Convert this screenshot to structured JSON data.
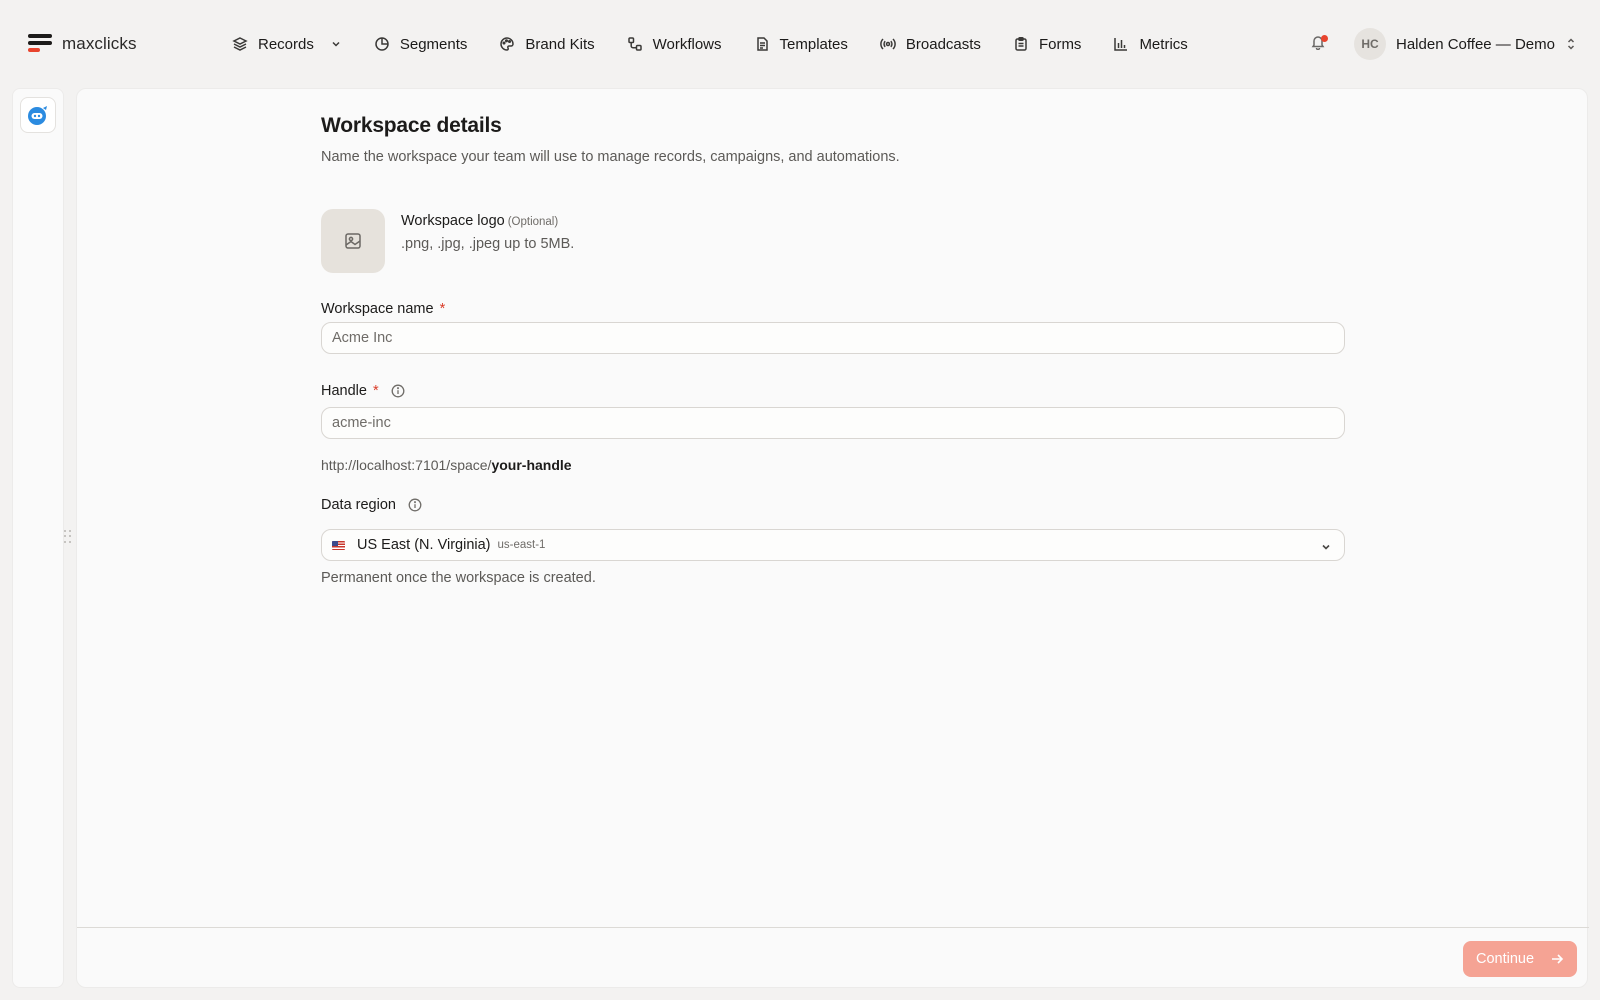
{
  "brand": {
    "name": "maxclicks"
  },
  "nav": [
    {
      "label": "Records",
      "icon": "layers-icon",
      "has_dropdown": true
    },
    {
      "label": "Segments",
      "icon": "pie-chart-icon"
    },
    {
      "label": "Brand Kits",
      "icon": "palette-icon"
    },
    {
      "label": "Workflows",
      "icon": "workflow-icon"
    },
    {
      "label": "Templates",
      "icon": "document-icon"
    },
    {
      "label": "Broadcasts",
      "icon": "broadcast-icon"
    },
    {
      "label": "Forms",
      "icon": "clipboard-icon"
    },
    {
      "label": "Metrics",
      "icon": "bar-chart-icon"
    }
  ],
  "notifications": {
    "icon": "bell-icon",
    "has_unread": true
  },
  "account": {
    "initials": "HC",
    "name": "Halden Coffee — Demo"
  },
  "form": {
    "title": "Workspace details",
    "subtitle": "Name the workspace your team will use to manage records, campaigns, and automations.",
    "logo": {
      "label": "Workspace logo",
      "optional": "(Optional)",
      "help": ".png, .jpg, .jpeg up to 5MB."
    },
    "name": {
      "label": "Workspace name",
      "required": "*",
      "placeholder": "Acme Inc",
      "value": ""
    },
    "handle": {
      "label": "Handle",
      "required": "*",
      "placeholder": "acme-inc",
      "value": "",
      "url_prefix": "http://localhost:7101/space/",
      "url_suffix": "your-handle"
    },
    "region": {
      "label": "Data region",
      "value": "US East (N. Virginia)",
      "code": "us-east-1",
      "help": "Permanent once the workspace is created."
    }
  },
  "footer": {
    "continue_label": "Continue"
  },
  "colors": {
    "accent": "#e8442e",
    "continue_bg": "#f5a394"
  }
}
